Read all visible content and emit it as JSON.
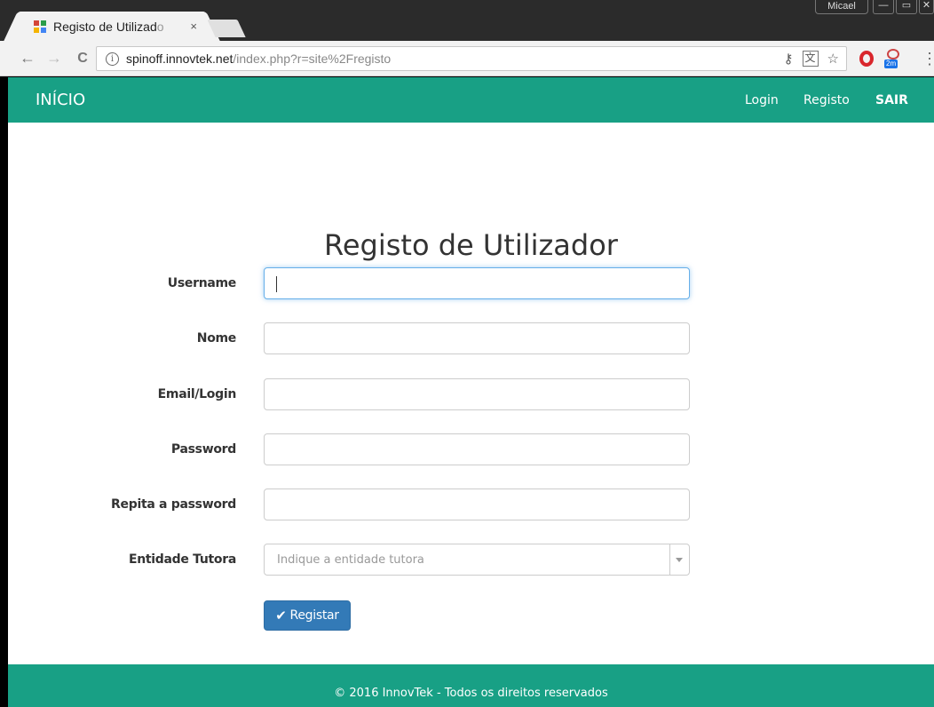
{
  "browser": {
    "tab_title_visible": "Registo de Utilizad",
    "tab_title_faded": "o",
    "tab_close": "×",
    "window_user": "Micael",
    "window_buttons": [
      "—",
      "▭",
      "✕"
    ],
    "url_host": "spinoff.innovtek.net",
    "url_path": "/index.php?r=site%2Fregisto",
    "info_glyph": "i",
    "nav": {
      "back": "←",
      "forward": "→",
      "reload": "C"
    },
    "ext_badge": "2m",
    "icons": [
      "back-icon",
      "forward-icon",
      "reload-icon",
      "info-icon",
      "key-icon",
      "translate-icon",
      "star-icon",
      "opera-icon",
      "extension-icon",
      "menu-icon"
    ],
    "colors": {
      "favicon": [
        "#d44638",
        "#2a9d4a",
        "#f4b400",
        "#4285f4"
      ]
    }
  },
  "navbar": {
    "brand": "INÍCIO",
    "links": [
      {
        "label": "Login"
      },
      {
        "label": "Registo"
      },
      {
        "label": "SAIR"
      }
    ],
    "color": "#18a085"
  },
  "form": {
    "title": "Registo de Utilizador",
    "fields": [
      {
        "label": "Username",
        "value": ""
      },
      {
        "label": "Nome",
        "value": ""
      },
      {
        "label": "Email/Login",
        "value": ""
      },
      {
        "label": "Password",
        "value": ""
      },
      {
        "label": "Repita a password",
        "value": ""
      }
    ],
    "select": {
      "label": "Entidade Tutora",
      "placeholder": "Indique a entidade tutora"
    },
    "submit_label": "Registar",
    "submit_color": "#337ab7"
  },
  "footer": {
    "text": "© 2016 InnovTek - Todos os direitos reservados"
  }
}
